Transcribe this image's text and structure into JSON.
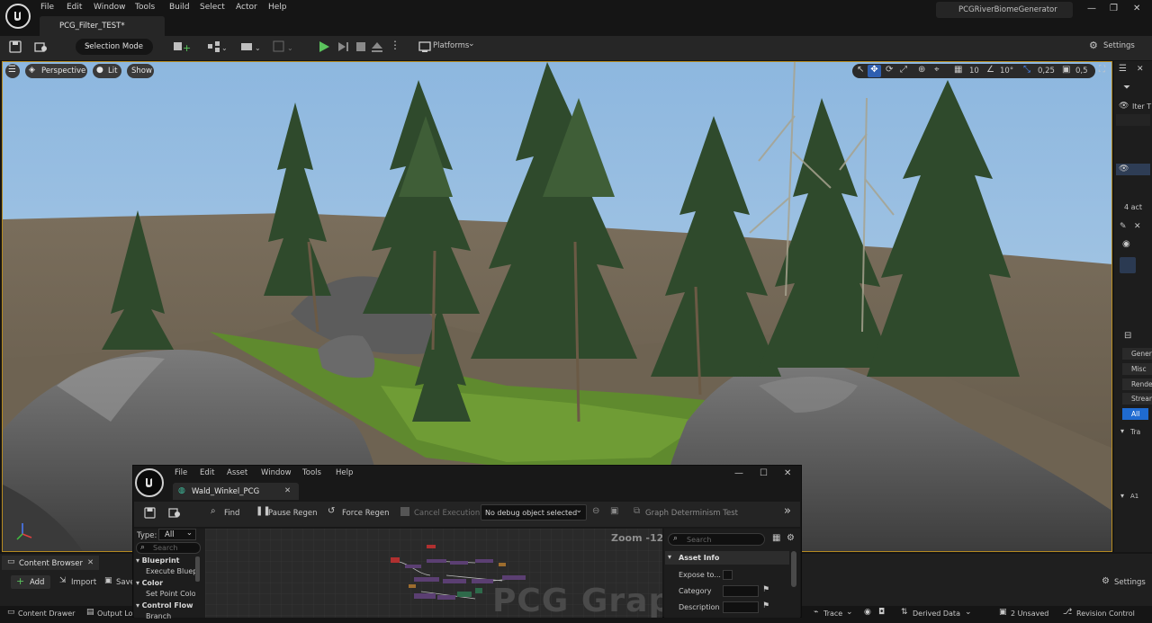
{
  "app": {
    "menu": [
      "File",
      "Edit",
      "Window",
      "Tools",
      "Build",
      "Select",
      "Actor",
      "Help"
    ],
    "document_tab": "PCG_Filter_TEST*",
    "project_name": "PCGRiverBiomeGenerator",
    "window_controls": [
      "—",
      "❐",
      "✕"
    ]
  },
  "toolbar": {
    "selection_mode": "Selection Mode",
    "platforms": "Platforms",
    "settings": "Settings"
  },
  "viewport": {
    "perspective": "Perspective",
    "lit": "Lit",
    "show": "Show",
    "grid_snap": "10",
    "rotation_snap": "10°",
    "scale_snap": "0,25",
    "camera_speed": "0,5"
  },
  "outliner": {
    "filter_text": "Iter T",
    "actor_count": "4 act",
    "details_tabs": [
      "Gener",
      "Misc",
      "Rende",
      "Stream",
      "All"
    ],
    "section": "Tra",
    "section2": "A1"
  },
  "content_browser": {
    "tab": "Content Browser",
    "add": "Add",
    "import": "Import",
    "save": "Save",
    "settings": "Settings"
  },
  "statusbar": {
    "content_drawer": "Content Drawer",
    "output_log": "Output Lo",
    "trace": "Trace",
    "derived_data": "Derived Data",
    "unsaved": "2 Unsaved",
    "revision_control": "Revision Control"
  },
  "pcg": {
    "menu": [
      "File",
      "Edit",
      "Asset",
      "Window",
      "Tools",
      "Help"
    ],
    "tab": "Wald_Winkel_PCG",
    "toolbar": {
      "find": "Find",
      "pause_regen": "Pause Regen",
      "force_regen": "Force Regen",
      "cancel_execution": "Cancel Execution",
      "debug_object": "No debug object selected",
      "determinism": "Graph Determinism Test"
    },
    "palette": {
      "type_label": "Type:",
      "type_value": "All",
      "search_placeholder": "Search",
      "items": [
        {
          "label": "Blueprint",
          "category": true
        },
        {
          "label": "Execute Bluep",
          "category": false
        },
        {
          "label": "Color",
          "category": true
        },
        {
          "label": "Set Point Colo",
          "category": false
        },
        {
          "label": "Control Flow",
          "category": true
        },
        {
          "label": "Branch",
          "category": false
        }
      ]
    },
    "graph": {
      "zoom": "Zoom -12",
      "watermark": "PCG Graph"
    },
    "details": {
      "search_placeholder": "Search",
      "section": "Asset Info",
      "rows": [
        "Expose to...",
        "Category",
        "Description"
      ]
    }
  }
}
